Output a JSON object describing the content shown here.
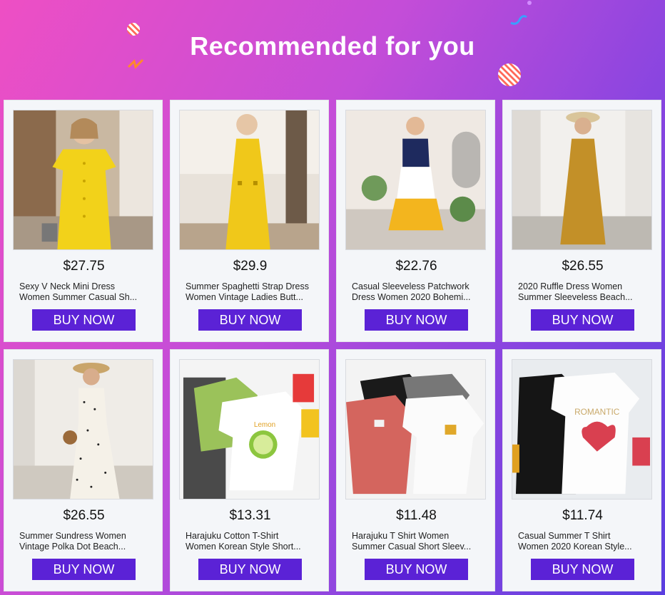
{
  "header": {
    "title": "Recommended for you"
  },
  "colors": {
    "buy_button": "#5b22d6",
    "card_bg": "#f4f6f9"
  },
  "products": [
    {
      "price": "$27.75",
      "name_line1": "Sexy V Neck Mini Dress",
      "name_line2": "Women Summer Casual Sh...",
      "buy_label": "BUY NOW",
      "image": "yellow-button-dress"
    },
    {
      "price": "$29.9",
      "name_line1": "Summer Spaghetti Strap Dress",
      "name_line2": "Women Vintage Ladies Butt...",
      "buy_label": "BUY NOW",
      "image": "yellow-strap-dress"
    },
    {
      "price": "$22.76",
      "name_line1": "Casual Sleeveless Patchwork",
      "name_line2": "Dress Women 2020 Bohemi...",
      "buy_label": "BUY NOW",
      "image": "patchwork-dress"
    },
    {
      "price": "$26.55",
      "name_line1": "2020 Ruffle Dress Women",
      "name_line2": "Summer Sleeveless Beach...",
      "buy_label": "BUY NOW",
      "image": "ruffle-dress"
    },
    {
      "price": "$26.55",
      "name_line1": "Summer Sundress Women",
      "name_line2": "Vintage Polka Dot Beach...",
      "buy_label": "BUY NOW",
      "image": "polka-dot-dress"
    },
    {
      "price": "$13.31",
      "name_line1": "Harajuku Cotton T-Shirt",
      "name_line2": "Women Korean Style Short...",
      "buy_label": "BUY NOW",
      "image": "lemon-tshirt"
    },
    {
      "price": "$11.48",
      "name_line1": "Harajuku T Shirt Women",
      "name_line2": "Summer Casual Short Sleev...",
      "buy_label": "BUY NOW",
      "image": "multicolor-tshirts"
    },
    {
      "price": "$11.74",
      "name_line1": "Casual Summer T Shirt",
      "name_line2": "Women 2020 Korean Style...",
      "buy_label": "BUY NOW",
      "image": "heart-tshirt"
    }
  ]
}
